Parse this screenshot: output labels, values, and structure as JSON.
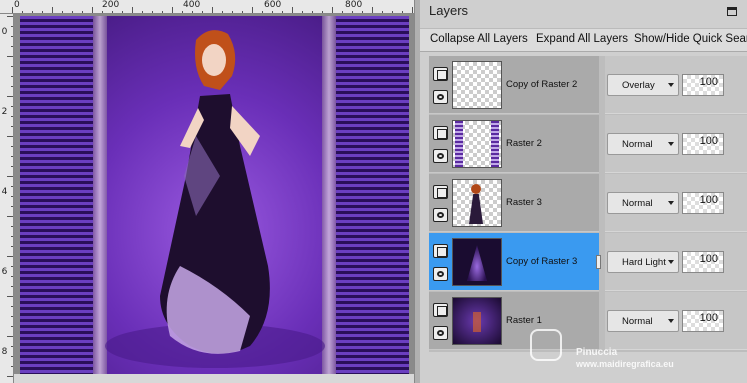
{
  "panel": {
    "title": "Layers",
    "toolbar": {
      "collapse_all": "Collapse All Layers",
      "expand_all": "Expand All Layers",
      "show_hide": "Show/Hide Quick Sear"
    }
  },
  "rulers": {
    "top_labels": [
      "0",
      "200",
      "400",
      "600",
      "800"
    ],
    "left_labels": [
      "0",
      "2",
      "4",
      "6",
      "8"
    ]
  },
  "layers": [
    {
      "name": "Copy of Raster 2",
      "blend_mode": "Overlay",
      "opacity": "100",
      "selected": false
    },
    {
      "name": "Raster 2",
      "blend_mode": "Normal",
      "opacity": "100",
      "selected": false
    },
    {
      "name": "Raster 3",
      "blend_mode": "Normal",
      "opacity": "100",
      "selected": false
    },
    {
      "name": "Copy of Raster 3",
      "blend_mode": "Hard Light",
      "opacity": "100",
      "selected": true
    },
    {
      "name": "Raster 1",
      "blend_mode": "Normal",
      "opacity": "100",
      "selected": false
    }
  ],
  "watermark": {
    "name": "Pinuccia",
    "site": "www.maidiregrafica.eu"
  },
  "colors": {
    "selection": "#3a9af0",
    "artwork_purple": "#6a2fb8",
    "panel_bg": "#cfcfcf"
  }
}
